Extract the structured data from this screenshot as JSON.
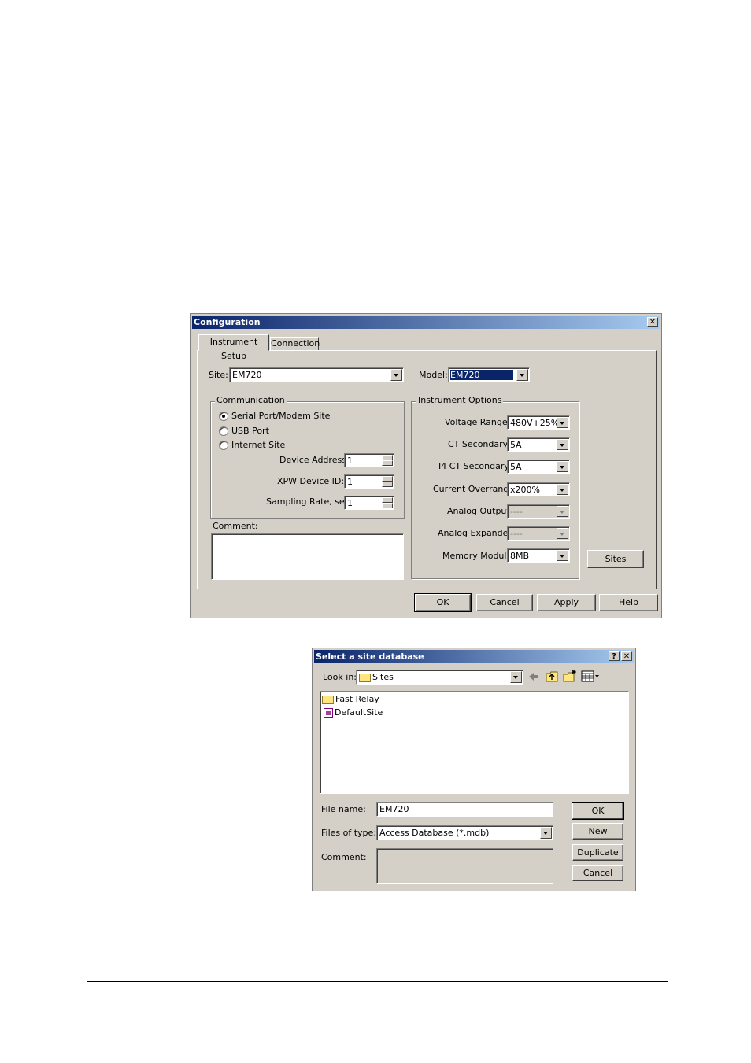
{
  "config_dialog": {
    "title": "Configuration",
    "tabs": [
      "Instrument Setup",
      "Connection"
    ],
    "site_label": "Site:",
    "site_value": "EM720",
    "model_label": "Model:",
    "model_value": "EM720",
    "communication": {
      "title": "Communication",
      "options": [
        "Serial Port/Modem Site",
        "USB Port",
        "Internet Site"
      ],
      "selected": "Serial Port/Modem Site",
      "device_address_label": "Device Address:",
      "device_address": "1",
      "xpw_label": "XPW Device ID:",
      "xpw_value": "1",
      "sampling_label": "Sampling Rate, sec:",
      "sampling_value": "1"
    },
    "comment_label": "Comment:",
    "instrument_options": {
      "title": "Instrument Options",
      "voltage_range_label": "Voltage Range:",
      "voltage_range": "480V+25%",
      "ct_secondary_label": "CT Secondary:",
      "ct_secondary": "5A",
      "i4_ct_label": "I4 CT Secondary:",
      "i4_ct": "5A",
      "current_overrange_label": "Current Overrange:",
      "current_overrange": "x200%",
      "analog_output_label": "Analog Output:",
      "analog_output": "----",
      "analog_expander_label": "Analog Expander:",
      "analog_expander": "----",
      "memory_module_label": "Memory Module:",
      "memory_module": "8MB"
    },
    "sites_button": "Sites",
    "ok_button": "OK",
    "cancel_button": "Cancel",
    "apply_button": "Apply",
    "help_button": "Help",
    "close_glyph": "✕"
  },
  "site_dialog": {
    "title": "Select a site database",
    "help_glyph": "?",
    "close_glyph": "✕",
    "look_in_label": "Look in:",
    "look_in_value": "Sites",
    "files": [
      {
        "name": "Fast Relay",
        "icon": "folder-icon"
      },
      {
        "name": "DefaultSite",
        "icon": "database-file-icon"
      }
    ],
    "file_name_label": "File name:",
    "file_name_value": "EM720",
    "files_of_type_label": "Files of type:",
    "files_of_type_value": "Access Database (*.mdb)",
    "comment_label": "Comment:",
    "ok_button": "OK",
    "new_button": "New",
    "duplicate_button": "Duplicate",
    "cancel_button": "Cancel"
  }
}
